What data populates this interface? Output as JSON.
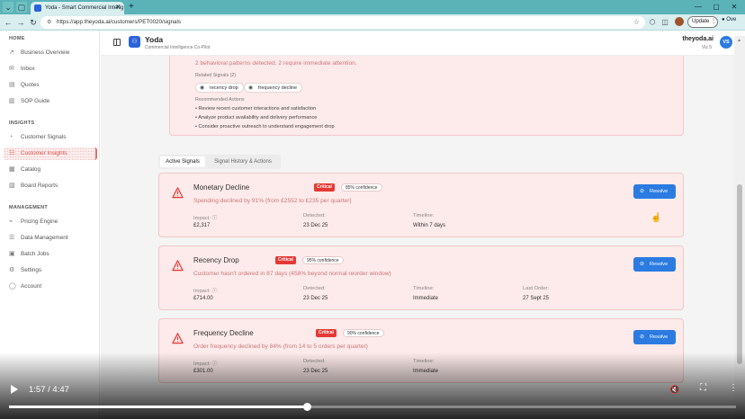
{
  "browser": {
    "tab_title": "Yoda - Smart Commercial Intellig",
    "url": "https://app.theyoda.ai/customers/PET0020/signals",
    "update_label": "Update",
    "extension_label": "Ove"
  },
  "header": {
    "brand": "Yoda",
    "tagline": "Commercial Intelligence Co-Pilot",
    "user_name": "theyoda.ai",
    "user_role": "Viz 5",
    "user_initials": "VS"
  },
  "sidebar": {
    "sections": [
      {
        "title": "HOME",
        "items": [
          {
            "label": "Business Overview",
            "icon": "trend-icon"
          },
          {
            "label": "Inbox",
            "icon": "inbox-icon"
          },
          {
            "label": "Quotes",
            "icon": "quote-icon"
          },
          {
            "label": "SOP Guide",
            "icon": "book-icon"
          }
        ]
      },
      {
        "title": "INSIGHTS",
        "items": [
          {
            "label": "Customer Signals",
            "icon": "signal-icon"
          },
          {
            "label": "Customer Insights",
            "icon": "users-icon",
            "active": true
          },
          {
            "label": "Catalog",
            "icon": "catalog-icon"
          },
          {
            "label": "Board Reports",
            "icon": "report-icon"
          }
        ]
      },
      {
        "title": "MANAGEMENT",
        "items": [
          {
            "label": "Pricing Engine",
            "icon": "pricing-icon"
          },
          {
            "label": "Data Management",
            "icon": "database-icon"
          },
          {
            "label": "Batch Jobs",
            "icon": "jobs-icon"
          },
          {
            "label": "Settings",
            "icon": "gear-icon"
          },
          {
            "label": "Account",
            "icon": "user-icon"
          }
        ]
      }
    ]
  },
  "summary": {
    "description": "2 behavioral patterns detected. 2 require immediate attention.",
    "related_label": "Related Signals (2)",
    "related": [
      "recency drop",
      "frequency decline"
    ],
    "recommended_label": "Recommended Actions",
    "actions": [
      "Review recent customer interactions and satisfaction",
      "Analyze product availability and delivery performance",
      "Consider proactive outreach to understand engagement drop"
    ]
  },
  "tabs": [
    "Active Signals",
    "Signal History & Actions"
  ],
  "signals": [
    {
      "title": "Monetary Decline",
      "severity": "Critical",
      "confidence": "85% confidence",
      "description": "Spending declined by 91% (from £2552 to £235 per quarter)",
      "impact_label": "Impact:",
      "impact": "£2,317",
      "detected_label": "Detected:",
      "detected": "23 Dec 25",
      "timeline_label": "Timeline:",
      "timeline": "Within 7 days",
      "resolve_label": "Resolve"
    },
    {
      "title": "Recency Drop",
      "severity": "Critical",
      "confidence": "95% confidence",
      "description": "Customer hasn't ordered in 87 days (458% beyond normal reorder window)",
      "impact_label": "Impact:",
      "impact": "£714.00",
      "detected_label": "Detected:",
      "detected": "23 Dec 25",
      "timeline_label": "Timeline:",
      "timeline": "Immediate",
      "last_order_label": "Last Order:",
      "last_order": "27 Sept 25",
      "resolve_label": "Resolve"
    },
    {
      "title": "Frequency Decline",
      "severity": "Critical",
      "confidence": "90% confidence",
      "description": "Order frequency declined by 84% (from 14 to 5 orders per quarter)",
      "impact_label": "Impact:",
      "impact": "£301.00",
      "detected_label": "Detected:",
      "detected": "23 Dec 25",
      "timeline_label": "Timeline:",
      "timeline": "Immediate",
      "resolve_label": "Resolve"
    }
  ],
  "video": {
    "time": "1:57 / 4:47",
    "progress": 0.41
  },
  "colors": {
    "accent": "#2b7be0",
    "critical": "#e53935",
    "card_bg": "#fdeaea",
    "active_nav": "#d9534f"
  }
}
